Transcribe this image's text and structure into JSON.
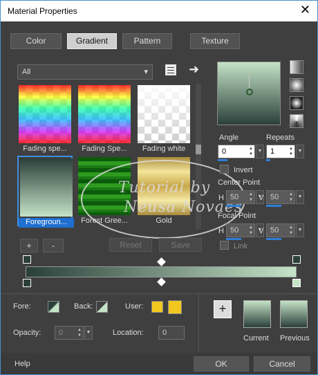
{
  "window": {
    "title": "Material Properties",
    "close": "✕"
  },
  "tabs": [
    "Color",
    "Gradient",
    "Pattern",
    "Texture"
  ],
  "category": {
    "value": "All"
  },
  "swatches": [
    {
      "label": "Fading spe..."
    },
    {
      "label": "Fading Spe..."
    },
    {
      "label": "Fading white"
    },
    {
      "label": "Foregroun..."
    },
    {
      "label": "Forest Gree..."
    },
    {
      "label": "Gold"
    }
  ],
  "list_buttons": {
    "add": "+",
    "remove": "-",
    "reset": "Reset",
    "save": "Save"
  },
  "angle": {
    "label": "Angle",
    "value": "0"
  },
  "repeats": {
    "label": "Repeats",
    "value": "1"
  },
  "invert": {
    "label": "Invert"
  },
  "center_point": {
    "label": "Center Point",
    "h_label": "H",
    "h_value": "50",
    "v_label": "V",
    "v_value": "50"
  },
  "focal_point": {
    "label": "Focal Point",
    "h_label": "H",
    "h_value": "50",
    "v_label": "V",
    "v_value": "50"
  },
  "link": {
    "label": "Link"
  },
  "colors_row": {
    "fore": "Fore:",
    "back": "Back:",
    "user": "User:",
    "user_color": "#f2c81e"
  },
  "opacity": {
    "label": "Opacity:",
    "value": "0"
  },
  "location": {
    "label": "Location:",
    "value": "0"
  },
  "add_button": "+",
  "current_label": "Current",
  "previous_label": "Previous",
  "footer": {
    "help": "Help",
    "ok": "OK",
    "cancel": "Cancel"
  },
  "watermark": {
    "line1": "Tutorial by",
    "line2": "Neusa Novaes"
  },
  "gradient_colors": {
    "dark": "#2b3f3a",
    "light": "#c4e3c7"
  }
}
